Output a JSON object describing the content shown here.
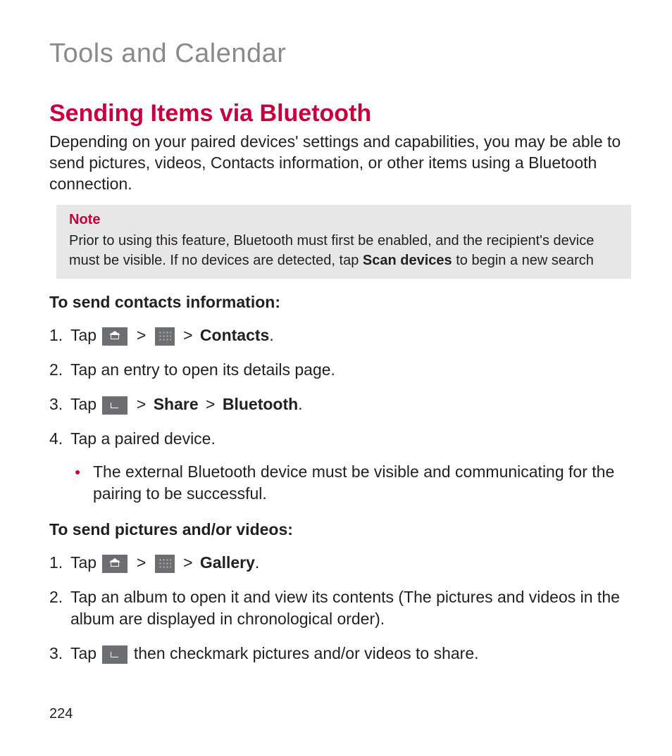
{
  "chapter": "Tools and Calendar",
  "section_title": "Sending Items via Bluetooth",
  "intro": "Depending on your paired devices' settings and capabilities, you may be able to send pictures, videos, Contacts information, or other items using a Bluetooth connection.",
  "note": {
    "label": "Note",
    "text_1": "Prior to using this feature, Bluetooth must first be enabled, and the recipient's device must be visible. If no devices are detected, tap ",
    "bold": "Scan devices",
    "text_2": " to begin a new search"
  },
  "contacts": {
    "heading": "To send contacts information:",
    "step1_lead": "Tap ",
    "step1_target": "Contacts",
    "step2": "Tap an entry to open its details page.",
    "step3_lead": "Tap ",
    "step3_a": "Share",
    "step3_b": "Bluetooth",
    "step4": "Tap a paired device.",
    "bullet": "The external Bluetooth device must be visible and communicating for the pairing to be successful."
  },
  "media": {
    "heading": "To send pictures and/or videos:",
    "step1_lead": "Tap ",
    "step1_target": "Gallery",
    "step2": "Tap an album to open it and view its contents (The pictures and videos in the album are displayed in chronological order).",
    "step3_lead": "Tap ",
    "step3_tail": " then checkmark pictures and/or videos to share."
  },
  "sep": ">",
  "period": ".",
  "page_number": "224"
}
